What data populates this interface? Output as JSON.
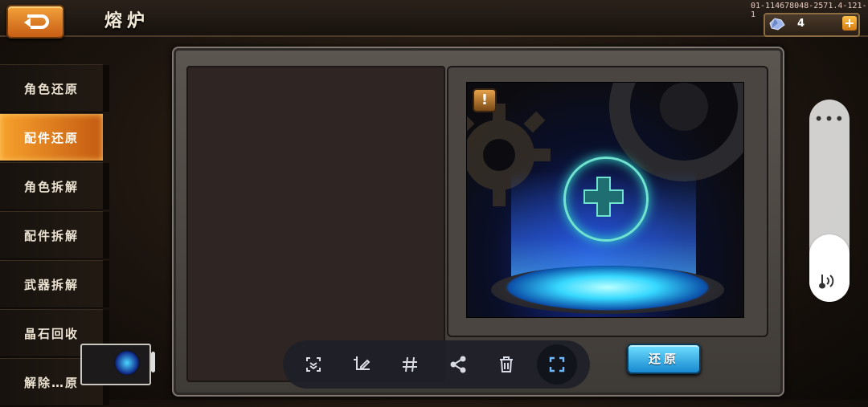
{
  "header": {
    "title": "熔炉",
    "back_icon": "back-arrow-icon",
    "build_id": "01-114678048-2571.4-121-1",
    "currency": {
      "icon": "gem-icon",
      "amount": "4",
      "add_icon": "plus-icon",
      "add_label": "+"
    }
  },
  "sidebar": {
    "items": [
      {
        "label": "角色还原",
        "active": false
      },
      {
        "label": "配件还原",
        "active": true
      },
      {
        "label": "角色拆解",
        "active": false
      },
      {
        "label": "配件拆解",
        "active": false
      },
      {
        "label": "武器拆解",
        "active": false
      },
      {
        "label": "晶石回收",
        "active": false
      },
      {
        "label": "解除…原",
        "active": false
      }
    ]
  },
  "main": {
    "warning_label": "!",
    "add_slot_icon": "plus-icon",
    "restore_button": "还原"
  },
  "screenshot_toolbar": {
    "tools": [
      "scroll-capture-icon",
      "edit-icon",
      "hash-icon",
      "share-icon",
      "delete-icon",
      "crop-icon"
    ],
    "active_tool": "crop-icon"
  },
  "volume": {
    "dots": "•••",
    "icon": "volume-icon",
    "level": 0.33
  },
  "colors": {
    "accent_orange": "#f7a12c",
    "accent_blue": "#1788d0",
    "glow_cyan": "#6fe2d0"
  }
}
